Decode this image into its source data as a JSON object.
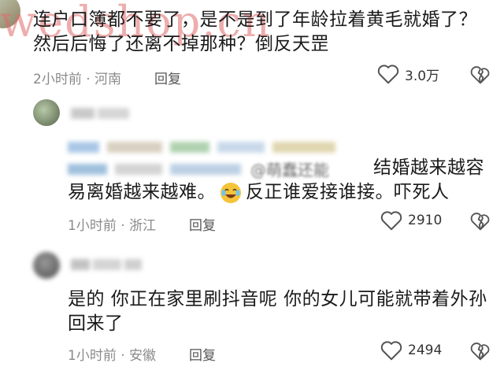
{
  "comments": [
    {
      "text_lines": [
        "连户口簿都不要了，是不是到了年龄拉着黄毛就婚了？",
        "然后后悔了还离不掉那种？倒反天罡"
      ],
      "meta": "2小时前 · 河南",
      "reply_label": "回复",
      "likes": "3.0万"
    },
    {
      "quote_visible_tail": "结婚越来越容",
      "quote_partial_mention": "@萌蠢还能",
      "text_lines": [
        "易离婚越来越难。",
        "反正谁爱接谁接。吓死人"
      ],
      "emoji_icon": "crying-laugh-emoji-icon",
      "meta": "1小时前 · 浙江",
      "reply_label": "回复",
      "likes": "2910"
    },
    {
      "text_lines": [
        "是的 你正在家里刷抖音呢 你的女儿可能就带着外孙",
        "回来了"
      ],
      "meta": "1小时前 · 安徽",
      "reply_label": "回复",
      "likes": "2494"
    }
  ],
  "watermark": "wedshop.cn",
  "icons": {
    "like": "heart-outline-icon",
    "dislike": "broken-heart-icon"
  },
  "colors": {
    "meta": "#8a8a8a",
    "watermark": "#e06a6a",
    "emoji": "#f5c43a"
  }
}
